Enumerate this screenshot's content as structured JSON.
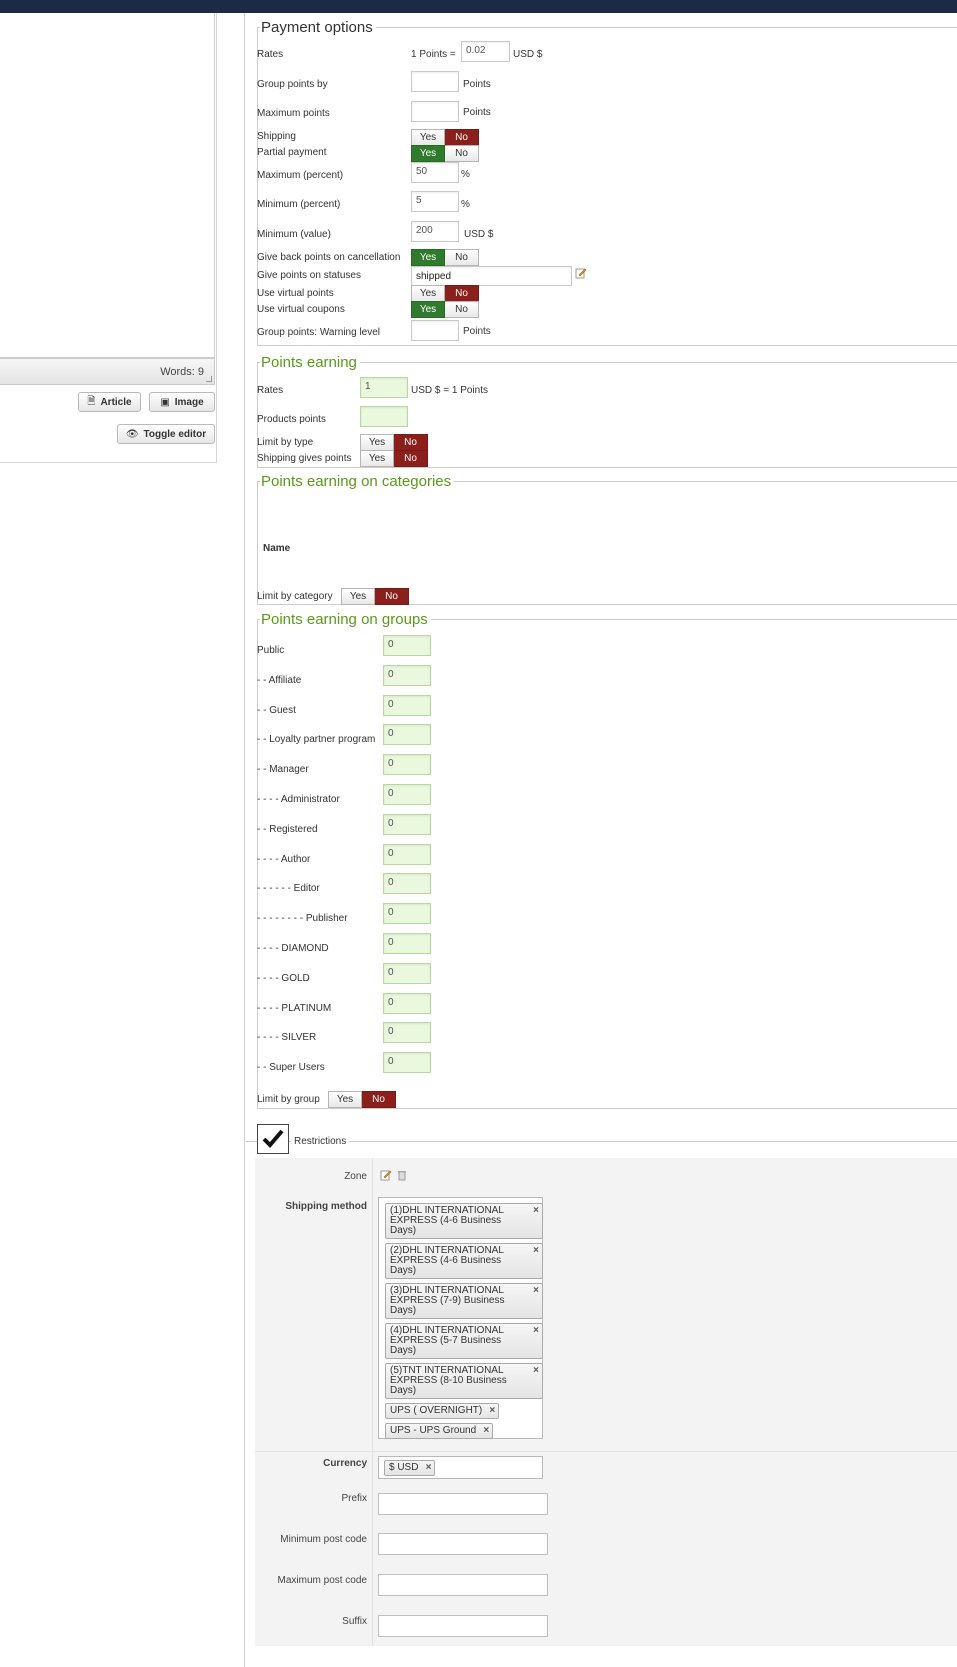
{
  "editor": {
    "words": "Words: 9",
    "article_button": "Article",
    "image_button": "Image",
    "toggle_editor_button": "Toggle editor"
  },
  "payment_options": {
    "legend": "Payment options",
    "rates_label": "Rates",
    "rates_prefix": "1 Points =",
    "rates_value": "0.02",
    "rates_unit": "USD $",
    "group_points_label": "Group points by",
    "group_points_unit": "Points",
    "max_points_label": "Maximum points",
    "max_points_unit": "Points",
    "shipping_label": "Shipping",
    "partial_payment_label": "Partial payment",
    "max_percent_label": "Maximum (percent)",
    "max_percent_value": "50",
    "min_percent_label": "Minimum (percent)",
    "min_percent_value": "5",
    "percent_unit": "%",
    "min_value_label": "Minimum (value)",
    "min_value_value": "200",
    "min_value_unit": "USD $",
    "give_back_label": "Give back points on cancellation",
    "give_points_statuses_label": "Give points on statuses",
    "give_points_statuses_value": "shipped",
    "use_virtual_points_label": "Use virtual points",
    "use_virtual_coupons_label": "Use virtual coupons",
    "warning_level_label": "Group points: Warning level",
    "warning_level_unit": "Points"
  },
  "toggle": {
    "yes": "Yes",
    "no": "No"
  },
  "points_earning": {
    "legend": "Points earning",
    "rates_label": "Rates",
    "rates_value": "1",
    "rates_suffix": "USD $ = 1 Points",
    "products_points_label": "Products points",
    "limit_by_type_label": "Limit by type",
    "shipping_gives_points_label": "Shipping gives points"
  },
  "categories": {
    "legend": "Points earning on categories",
    "name_header": "Name",
    "limit_label": "Limit by category"
  },
  "groups": {
    "legend": "Points earning on groups",
    "items": [
      {
        "label": "Public",
        "value": "0"
      },
      {
        "label": "- - Affiliate",
        "value": "0"
      },
      {
        "label": "- - Guest",
        "value": "0"
      },
      {
        "label": "- - Loyalty partner program",
        "value": "0"
      },
      {
        "label": "- - Manager",
        "value": "0"
      },
      {
        "label": "- - - - Administrator",
        "value": "0"
      },
      {
        "label": "- - Registered",
        "value": "0"
      },
      {
        "label": "- - - - Author",
        "value": "0"
      },
      {
        "label": "- - - - - - Editor",
        "value": "0"
      },
      {
        "label": "- - - - - - - - Publisher",
        "value": "0"
      },
      {
        "label": "- - - - DIAMOND",
        "value": "0"
      },
      {
        "label": "- - - - GOLD",
        "value": "0"
      },
      {
        "label": "- - - - PLATINUM",
        "value": "0"
      },
      {
        "label": "- - - - SILVER",
        "value": "0"
      },
      {
        "label": "- - Super Users",
        "value": "0"
      }
    ],
    "limit_label": "Limit by group"
  },
  "restrictions": {
    "legend": "Restrictions",
    "zone_label": "Zone",
    "shipping_method_label": "Shipping method",
    "shipping_methods": [
      "(1)DHL INTERNATIONAL EXPRESS (4-6 Business Days)",
      "(2)DHL INTERNATIONAL EXPRESS (4-6 Business Days)",
      "(3)DHL INTERNATIONAL EXPRESS (7-9) Business Days)",
      "(4)DHL INTERNATIONAL EXPRESS (5-7 Business Days)",
      "(5)TNT INTERNATIONAL EXPRESS (8-10 Business Days)",
      "UPS ( OVERNIGHT)",
      "UPS - UPS Ground"
    ],
    "currency_label": "Currency",
    "currency_tag": "$ USD",
    "prefix_label": "Prefix",
    "min_post_code_label": "Minimum post code",
    "max_post_code_label": "Maximum post code",
    "suffix_label": "Suffix"
  },
  "colors": {
    "toggle_on_no": "#8b1f1b",
    "toggle_on_yes": "#2f7a2c",
    "legend_green": "#5a9a1a",
    "topbar": "#1b2a47"
  }
}
